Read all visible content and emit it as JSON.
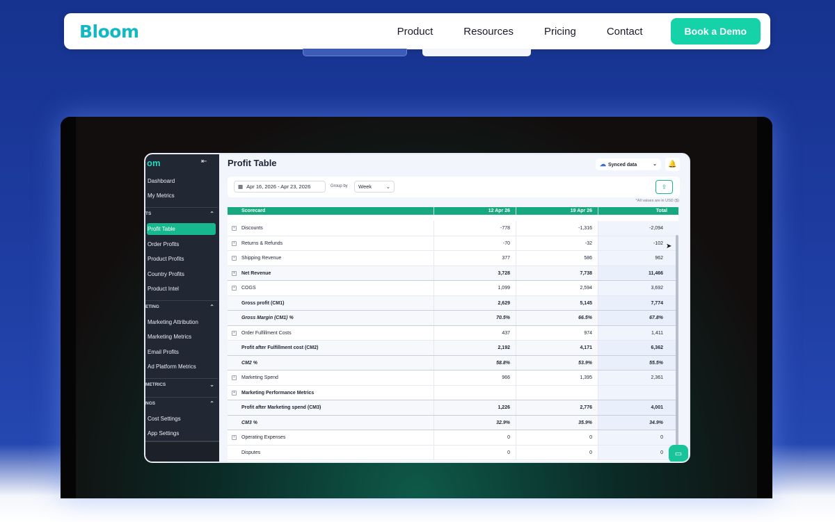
{
  "site": {
    "logo": "Bloom",
    "nav": [
      "Product",
      "Resources",
      "Pricing",
      "Contact"
    ],
    "cta": "Book a Demo"
  },
  "app": {
    "sidebar": {
      "logo": "om",
      "items_top": [
        "Dashboard",
        "My Metrics"
      ],
      "section1": "TS",
      "items1": [
        "Profit Table",
        "Order Profits",
        "Product Profits",
        "Country Profits",
        "Product Intel"
      ],
      "section2": "ETING",
      "items2": [
        "Marketing Attribution",
        "Marketing Metrics",
        "Email Profits",
        "Ad Platform Metrics"
      ],
      "section3": "METRICS",
      "section4": "NGS",
      "items4": [
        "Cost Settings",
        "App Settings"
      ]
    },
    "title": "Profit Table",
    "synced": "Synced data",
    "date_range": "Apr 16, 2026 - Apr 23, 2026",
    "group_label": "Group by",
    "group_value": "Week",
    "usd_note": "*All values are in USD ($)",
    "columns": [
      "Scorecard",
      "12 Apr 26",
      "19 Apr 26",
      "Total"
    ],
    "rows": [
      {
        "label": "Discounts",
        "v1": "-778",
        "v2": "-1,316",
        "v3": "-2,094",
        "exp": true,
        "style": ""
      },
      {
        "label": "Returns & Refunds",
        "v1": "-70",
        "v2": "-32",
        "v3": "-102",
        "exp": true,
        "style": ""
      },
      {
        "label": "Shipping Revenue",
        "v1": "377",
        "v2": "586",
        "v3": "962",
        "exp": true,
        "style": ""
      },
      {
        "label": "Net Revenue",
        "v1": "3,728",
        "v2": "7,738",
        "v3": "11,466",
        "exp": true,
        "style": "bold"
      },
      {
        "label": "COGS",
        "v1": "1,099",
        "v2": "2,594",
        "v3": "3,692",
        "exp": true,
        "style": ""
      },
      {
        "label": "Gross profit (CM1)",
        "v1": "2,629",
        "v2": "5,145",
        "v3": "7,774",
        "exp": false,
        "style": "bold"
      },
      {
        "label": "Gross Margin (CM1) %",
        "v1": "70.5%",
        "v2": "66.5%",
        "v3": "67.8%",
        "exp": false,
        "style": "bold italic"
      },
      {
        "label": "Order Fulfillment Costs",
        "v1": "437",
        "v2": "974",
        "v3": "1,411",
        "exp": true,
        "style": ""
      },
      {
        "label": "Profit after Fulfillment cost (CM2)",
        "v1": "2,192",
        "v2": "4,171",
        "v3": "6,362",
        "exp": false,
        "style": "bold"
      },
      {
        "label": "CM2 %",
        "v1": "58.8%",
        "v2": "53.9%",
        "v3": "55.5%",
        "exp": false,
        "style": "bold italic"
      },
      {
        "label": "Marketing Spend",
        "v1": "966",
        "v2": "1,395",
        "v3": "2,361",
        "exp": true,
        "style": ""
      },
      {
        "label": "Marketing Performance Metrics",
        "v1": "",
        "v2": "",
        "v3": "",
        "exp": true,
        "style": "bold nobg"
      },
      {
        "label": "Profit after Marketing spend (CM3)",
        "v1": "1,226",
        "v2": "2,776",
        "v3": "4,001",
        "exp": false,
        "style": "bold"
      },
      {
        "label": "CM3 %",
        "v1": "32.9%",
        "v2": "35.9%",
        "v3": "34.9%",
        "exp": false,
        "style": "bold italic"
      },
      {
        "label": "Operating Expenses",
        "v1": "0",
        "v2": "0",
        "v3": "0",
        "exp": true,
        "style": ""
      },
      {
        "label": "Disputes",
        "v1": "0",
        "v2": "0",
        "v3": "0",
        "exp": false,
        "style": ""
      }
    ]
  },
  "colors": {
    "accent": "#16d2a8",
    "brand": "#14b8c4",
    "sidebar": "#222833"
  }
}
